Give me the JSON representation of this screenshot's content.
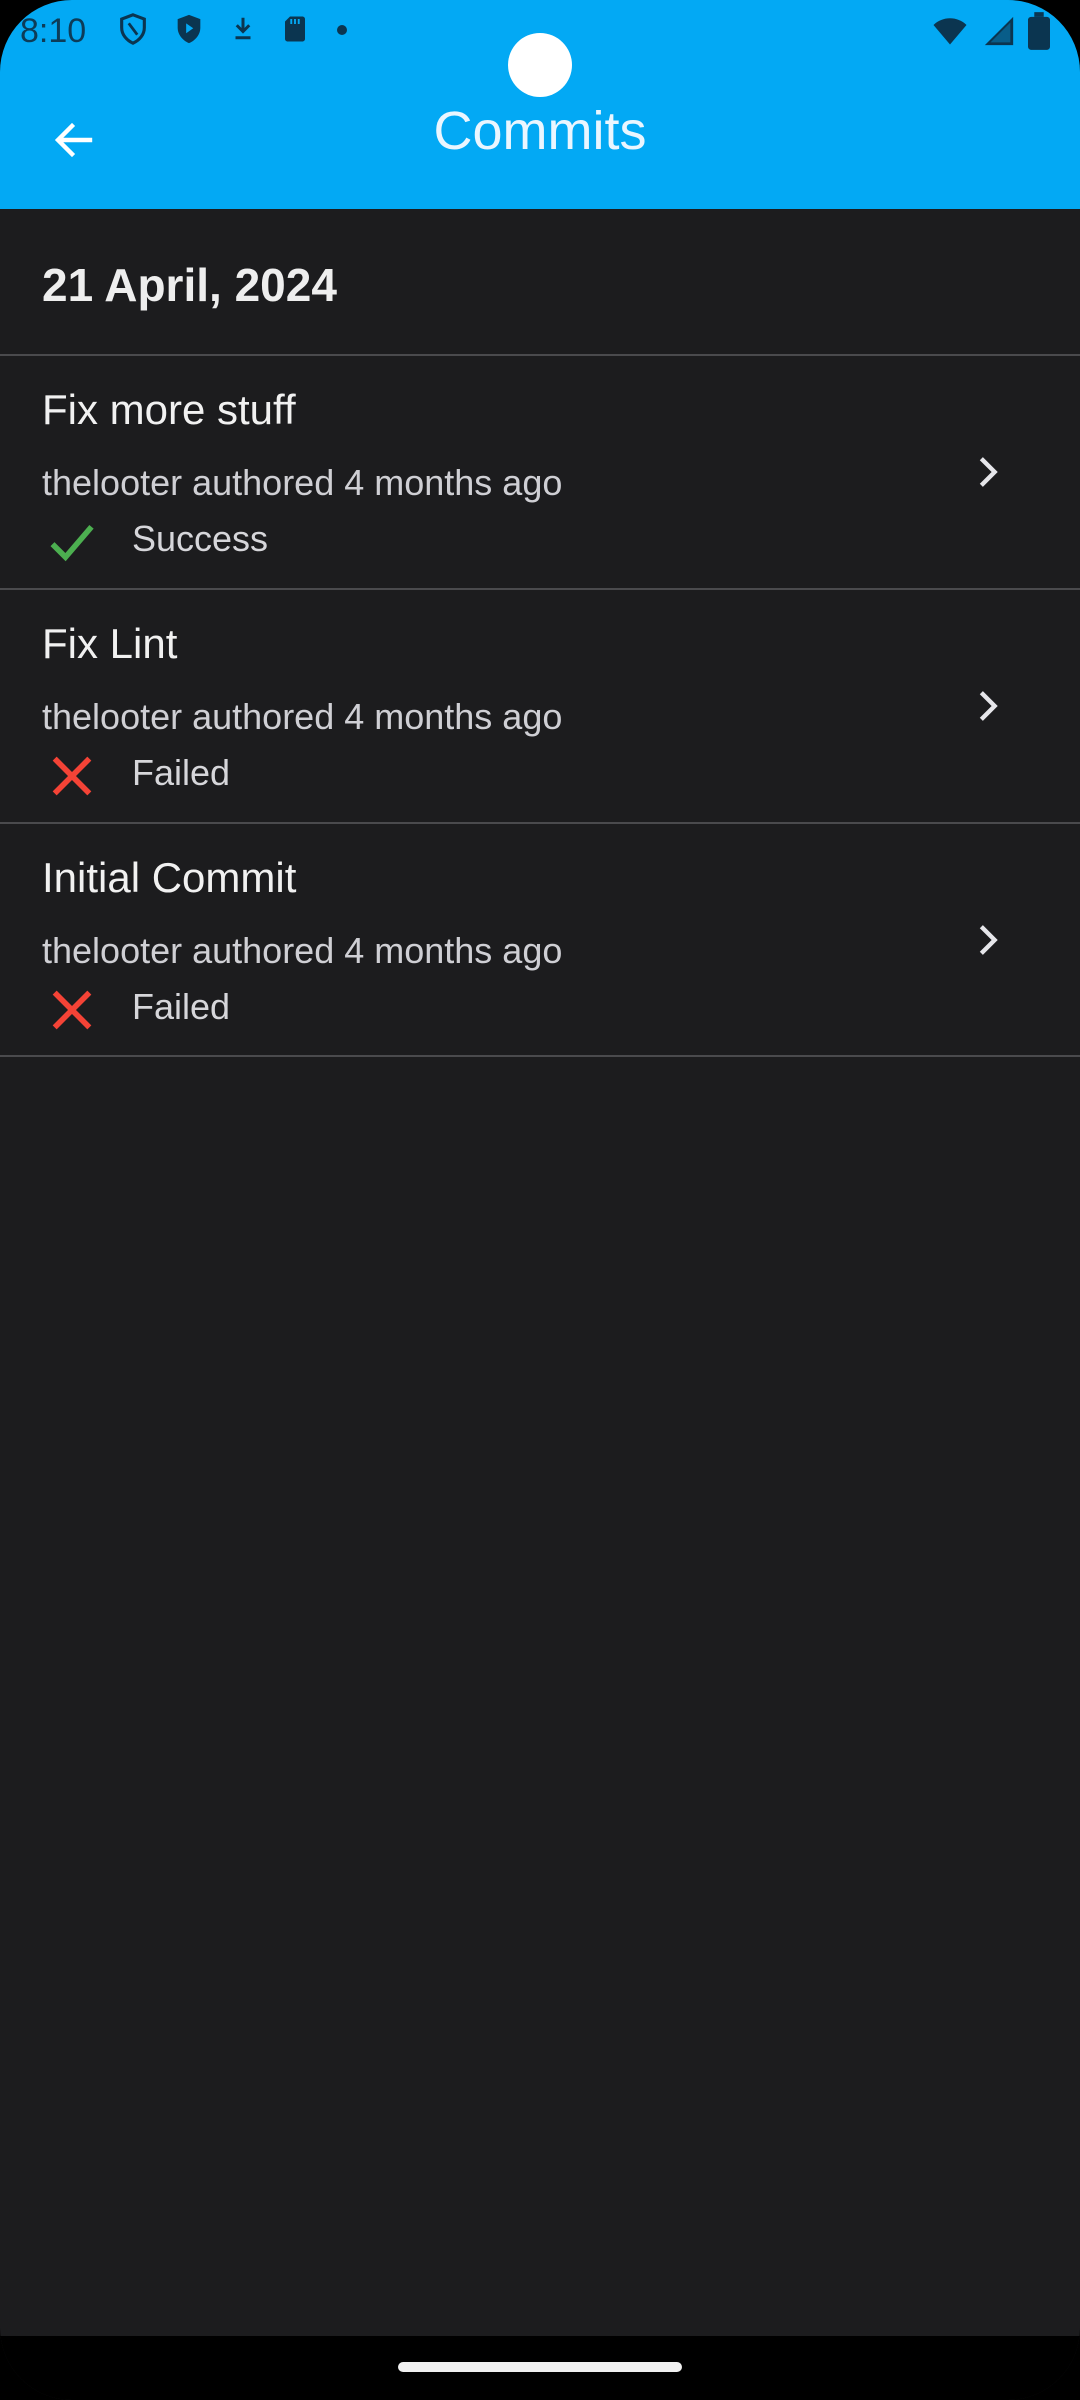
{
  "status_bar": {
    "time": "8:10",
    "icons_left": [
      "shield-outline-icon",
      "shield-play-icon",
      "download-icon",
      "sd-card-icon",
      "dot-icon"
    ],
    "icons_right": [
      "wifi-icon",
      "signal-icon",
      "battery-icon"
    ]
  },
  "app_bar": {
    "title": "Commits",
    "back_icon": "arrow-left-icon",
    "background_color": "#03a9f4"
  },
  "section": {
    "date": "21 April, 2024"
  },
  "commits": [
    {
      "title": "Fix more stuff",
      "meta": "thelooter authored 4 months ago",
      "status": "Success",
      "status_icon": "check-icon",
      "status_color": "#4caf50"
    },
    {
      "title": "Fix Lint",
      "meta": "thelooter authored 4 months ago",
      "status": "Failed",
      "status_icon": "close-icon",
      "status_color": "#f44336"
    },
    {
      "title": "Initial Commit",
      "meta": "thelooter authored 4 months ago",
      "status": "Failed",
      "status_icon": "close-icon",
      "status_color": "#f44336"
    }
  ]
}
